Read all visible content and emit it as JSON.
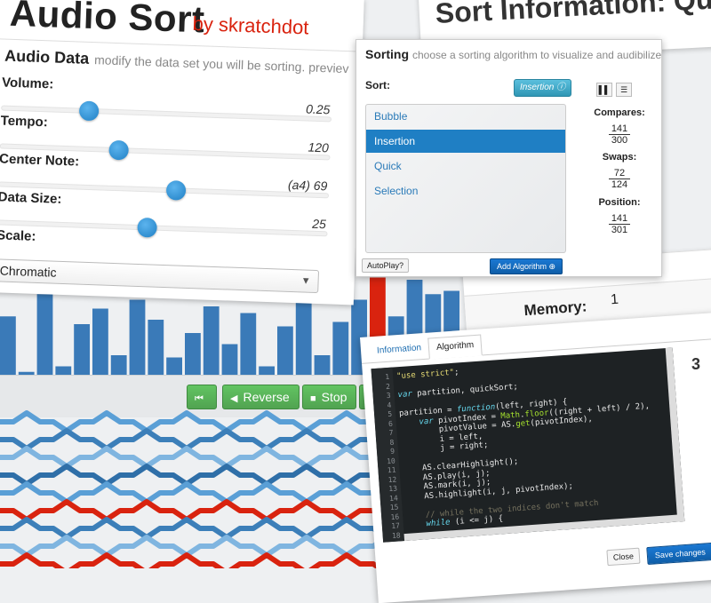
{
  "app": {
    "title": "Audio Sort",
    "byline": "by skratchdot"
  },
  "audio_data": {
    "heading": "Audio Data",
    "subheading": "modify the data set you will be sorting. previev",
    "params": [
      {
        "label": "Volume:",
        "value": "0.25",
        "level": 0.25
      },
      {
        "label": "Tempo:",
        "value": "120",
        "level": 0.35
      },
      {
        "label": "Center Note:",
        "value": "(a4) 69",
        "level": 0.54
      },
      {
        "label": "Data Size:",
        "value": "25",
        "level": 0.45
      }
    ],
    "scale_label": "Scale:",
    "scale_value": "Chromatic"
  },
  "playback": {
    "reverse_label": "Reverse",
    "stop_label": "Stop"
  },
  "sort_info": {
    "heading": "Sort Information: Quic",
    "memory_label": "Memory:",
    "memory_value": "1",
    "side_value": "3"
  },
  "sorting": {
    "title": "Sorting",
    "subtitle": "choose a sorting algorithm to visualize and audibilize",
    "sort_label": "Sort:",
    "selected_algorithm": "Insertion",
    "algorithms": [
      "Bubble",
      "Insertion",
      "Quick",
      "Selection"
    ],
    "stats": {
      "compares_label": "Compares:",
      "compares_num": "141",
      "compares_den": "300",
      "swaps_label": "Swaps:",
      "swaps_num": "72",
      "swaps_den": "124",
      "position_label": "Position:",
      "position_num": "141",
      "position_den": "301"
    },
    "autoplay_label": "AutoPlay?",
    "add_algorithm_label": "Add Algorithm"
  },
  "code": {
    "tabs": [
      "Information",
      "Algorithm"
    ],
    "active_tab": "Algorithm",
    "line_numbers": [
      "1",
      "2",
      "3",
      "4",
      "5",
      "6",
      "7",
      "8",
      "9",
      "10",
      "11",
      "12",
      "13",
      "14",
      "15",
      "16",
      "17",
      "18"
    ],
    "lines": [
      "\"use strict\";",
      "",
      "var partition, quickSort;",
      "",
      "partition = function(left, right) {",
      "    var pivotIndex = Math.floor((right + left) / 2),",
      "        pivotValue = AS.get(pivotIndex),",
      "        i = left,",
      "        j = right;",
      "",
      "    AS.clearHighlight();",
      "    AS.play(i, j);",
      "    AS.mark(i, j);",
      "    AS.highlight(i, j, pivotIndex);",
      "",
      "    // while the two indices don't match",
      "    while (i <= j) {",
      ""
    ],
    "close_label": "Close",
    "save_label": "Save changes"
  },
  "bars_chart": {
    "values": [
      0.55,
      0.05,
      0.75,
      0.1,
      0.48,
      0.62,
      0.2,
      0.7,
      0.52,
      0.18,
      0.4,
      0.64,
      0.3,
      0.58,
      0.1,
      0.46,
      0.72,
      0.2,
      0.5,
      0.7,
      0.9,
      0.55,
      0.88,
      0.75,
      0.78
    ],
    "highlight_index": 20,
    "bar_color": "#3a7ab8",
    "highlight_color": "#d9230f"
  },
  "colors": {
    "accent": "#1f7fc4",
    "title_red": "#d9230f",
    "green_button": "#51a351"
  }
}
